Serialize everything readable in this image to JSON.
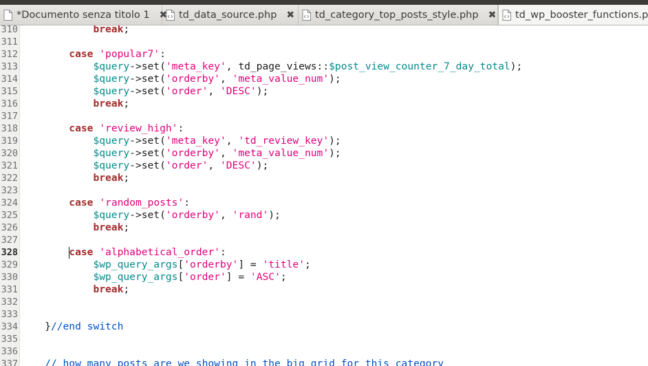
{
  "tabs": [
    {
      "label": "*Documento senza titolo 1",
      "close": "✖",
      "active": false,
      "icon": "file-icon"
    },
    {
      "label": "td_data_source.php",
      "close": "✖",
      "active": false,
      "icon": "code-file-icon"
    },
    {
      "label": "td_category_top_posts_style.php",
      "close": "✖",
      "active": false,
      "icon": "code-file-icon"
    },
    {
      "label": "td_wp_booster_functions.ph",
      "close": "",
      "active": true,
      "icon": "code-file-icon"
    }
  ],
  "colors": {
    "keyword": "#a52a2a",
    "string": "#e0007a",
    "variable": "#008a8c",
    "comment": "#0050c8"
  },
  "current_line": "328",
  "lines": [
    {
      "n": "310",
      "tokens": [
        {
          "t": "            "
        },
        {
          "t": "break",
          "c": "kw"
        },
        {
          "t": ";"
        }
      ]
    },
    {
      "n": "311",
      "tokens": []
    },
    {
      "n": "312",
      "tokens": [
        {
          "t": "        "
        },
        {
          "t": "case",
          "c": "kw"
        },
        {
          "t": " "
        },
        {
          "t": "'popular7'",
          "c": "str"
        },
        {
          "t": ":"
        }
      ]
    },
    {
      "n": "313",
      "tokens": [
        {
          "t": "            "
        },
        {
          "t": "$query",
          "c": "var"
        },
        {
          "t": "->set("
        },
        {
          "t": "'meta_key'",
          "c": "str"
        },
        {
          "t": ", td_page_views::"
        },
        {
          "t": "$post_view_counter_7_day_total",
          "c": "var"
        },
        {
          "t": ");"
        }
      ]
    },
    {
      "n": "314",
      "tokens": [
        {
          "t": "            "
        },
        {
          "t": "$query",
          "c": "var"
        },
        {
          "t": "->set("
        },
        {
          "t": "'orderby'",
          "c": "str"
        },
        {
          "t": ", "
        },
        {
          "t": "'meta_value_num'",
          "c": "str"
        },
        {
          "t": ");"
        }
      ]
    },
    {
      "n": "315",
      "tokens": [
        {
          "t": "            "
        },
        {
          "t": "$query",
          "c": "var"
        },
        {
          "t": "->set("
        },
        {
          "t": "'order'",
          "c": "str"
        },
        {
          "t": ", "
        },
        {
          "t": "'DESC'",
          "c": "str"
        },
        {
          "t": ");"
        }
      ]
    },
    {
      "n": "316",
      "tokens": [
        {
          "t": "            "
        },
        {
          "t": "break",
          "c": "kw"
        },
        {
          "t": ";"
        }
      ]
    },
    {
      "n": "317",
      "tokens": []
    },
    {
      "n": "318",
      "tokens": [
        {
          "t": "        "
        },
        {
          "t": "case",
          "c": "kw"
        },
        {
          "t": " "
        },
        {
          "t": "'review_high'",
          "c": "str"
        },
        {
          "t": ":"
        }
      ]
    },
    {
      "n": "319",
      "tokens": [
        {
          "t": "            "
        },
        {
          "t": "$query",
          "c": "var"
        },
        {
          "t": "->set("
        },
        {
          "t": "'meta_key'",
          "c": "str"
        },
        {
          "t": ", "
        },
        {
          "t": "'td_review_key'",
          "c": "str"
        },
        {
          "t": ");"
        }
      ]
    },
    {
      "n": "320",
      "tokens": [
        {
          "t": "            "
        },
        {
          "t": "$query",
          "c": "var"
        },
        {
          "t": "->set("
        },
        {
          "t": "'orderby'",
          "c": "str"
        },
        {
          "t": ", "
        },
        {
          "t": "'meta_value_num'",
          "c": "str"
        },
        {
          "t": ");"
        }
      ]
    },
    {
      "n": "321",
      "tokens": [
        {
          "t": "            "
        },
        {
          "t": "$query",
          "c": "var"
        },
        {
          "t": "->set("
        },
        {
          "t": "'order'",
          "c": "str"
        },
        {
          "t": ", "
        },
        {
          "t": "'DESC'",
          "c": "str"
        },
        {
          "t": ");"
        }
      ]
    },
    {
      "n": "322",
      "tokens": [
        {
          "t": "            "
        },
        {
          "t": "break",
          "c": "kw"
        },
        {
          "t": ";"
        }
      ]
    },
    {
      "n": "323",
      "tokens": []
    },
    {
      "n": "324",
      "tokens": [
        {
          "t": "        "
        },
        {
          "t": "case",
          "c": "kw"
        },
        {
          "t": " "
        },
        {
          "t": "'random_posts'",
          "c": "str"
        },
        {
          "t": ":"
        }
      ]
    },
    {
      "n": "325",
      "tokens": [
        {
          "t": "            "
        },
        {
          "t": "$query",
          "c": "var"
        },
        {
          "t": "->set("
        },
        {
          "t": "'orderby'",
          "c": "str"
        },
        {
          "t": ", "
        },
        {
          "t": "'rand'",
          "c": "str"
        },
        {
          "t": ");"
        }
      ]
    },
    {
      "n": "326",
      "tokens": [
        {
          "t": "            "
        },
        {
          "t": "break",
          "c": "kw"
        },
        {
          "t": ";"
        }
      ]
    },
    {
      "n": "327",
      "tokens": []
    },
    {
      "n": "328",
      "tokens": [
        {
          "t": "        "
        },
        {
          "t": "case",
          "c": "kw"
        },
        {
          "t": " "
        },
        {
          "t": "'alphabetical_order'",
          "c": "str"
        },
        {
          "t": ":"
        }
      ]
    },
    {
      "n": "329",
      "tokens": [
        {
          "t": "            "
        },
        {
          "t": "$wp_query_args",
          "c": "var"
        },
        {
          "t": "["
        },
        {
          "t": "'orderby'",
          "c": "str"
        },
        {
          "t": "] = "
        },
        {
          "t": "'title'",
          "c": "str"
        },
        {
          "t": ";"
        }
      ]
    },
    {
      "n": "330",
      "tokens": [
        {
          "t": "            "
        },
        {
          "t": "$wp_query_args",
          "c": "var"
        },
        {
          "t": "["
        },
        {
          "t": "'order'",
          "c": "str"
        },
        {
          "t": "] = "
        },
        {
          "t": "'ASC'",
          "c": "str"
        },
        {
          "t": ";"
        }
      ]
    },
    {
      "n": "331",
      "tokens": [
        {
          "t": "            "
        },
        {
          "t": "break",
          "c": "kw"
        },
        {
          "t": ";"
        }
      ]
    },
    {
      "n": "332",
      "tokens": []
    },
    {
      "n": "333",
      "tokens": []
    },
    {
      "n": "334",
      "tokens": [
        {
          "t": "    }"
        },
        {
          "t": "//end switch",
          "c": "cmt"
        }
      ]
    },
    {
      "n": "335",
      "tokens": []
    },
    {
      "n": "336",
      "tokens": []
    },
    {
      "n": "337",
      "tokens": [
        {
          "t": "    "
        },
        {
          "t": "// how many posts are we showing in the big grid for this category",
          "c": "cmt"
        }
      ]
    }
  ]
}
